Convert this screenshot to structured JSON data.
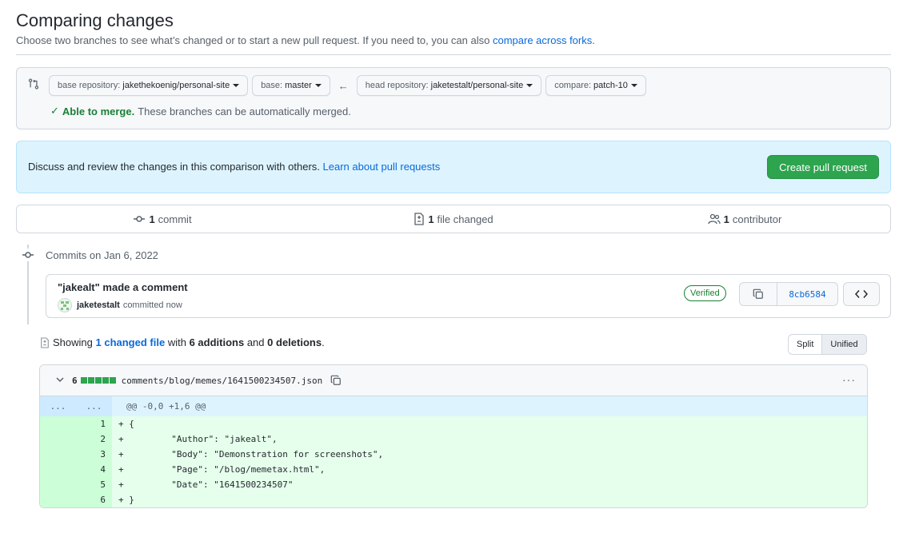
{
  "header": {
    "title": "Comparing changes",
    "subtitle": "Choose two branches to see what’s changed or to start a new pull request. If you need to, you can also",
    "subtitle_link": "compare across forks",
    "subtitle_end": "."
  },
  "range": {
    "base_repo_label": "base repository:",
    "base_repo": "jakethekoenig/personal-site",
    "base_label": "base:",
    "base": "master",
    "head_repo_label": "head repository:",
    "head_repo": "jaketestalt/personal-site",
    "compare_label": "compare:",
    "compare": "patch-10",
    "merge_ok": "Able to merge.",
    "merge_text": "These branches can be automatically merged."
  },
  "blankslate": {
    "text": "Discuss and review the changes in this comparison with others.",
    "link": "Learn about pull requests",
    "button": "Create pull request"
  },
  "summary": {
    "commits_count": "1",
    "commits_label": "commit",
    "files_count": "1",
    "files_label": "file changed",
    "contributors_count": "1",
    "contributors_label": "contributor"
  },
  "commits": {
    "date_label": "Commits on Jan 6, 2022",
    "items": [
      {
        "title": "\"jakealt\" made a comment",
        "author": "jaketestalt",
        "meta": "committed now",
        "verified": "Verified",
        "sha": "8cb6584"
      }
    ]
  },
  "diff_summary": {
    "showing": "Showing",
    "changed_link": "1 changed file",
    "with": "with",
    "additions": "6 additions",
    "and": "and",
    "deletions": "0 deletions",
    "end": "."
  },
  "view_toggle": {
    "split": "Split",
    "unified": "Unified"
  },
  "file": {
    "additions_count": "6",
    "path": "comments/blog/memes/1641500234507.json",
    "more": "···",
    "hunk_left": "...",
    "hunk_right": "...",
    "hunk_header": "@@ -0,0 +1,6 @@",
    "lines": [
      {
        "num": "1",
        "code": "+ {"
      },
      {
        "num": "2",
        "code": "+         \"Author\": \"jakealt\","
      },
      {
        "num": "3",
        "code": "+         \"Body\": \"Demonstration for screenshots\","
      },
      {
        "num": "4",
        "code": "+         \"Page\": \"/blog/memetax.html\","
      },
      {
        "num": "5",
        "code": "+         \"Date\": \"1641500234507\""
      },
      {
        "num": "6",
        "code": "+ }"
      }
    ]
  },
  "colors": {
    "accent": "#0969da",
    "success": "#2da44e",
    "add_bg": "#e6ffec",
    "add_num_bg": "#ccffd8",
    "hunk_bg": "#ddf4ff"
  }
}
